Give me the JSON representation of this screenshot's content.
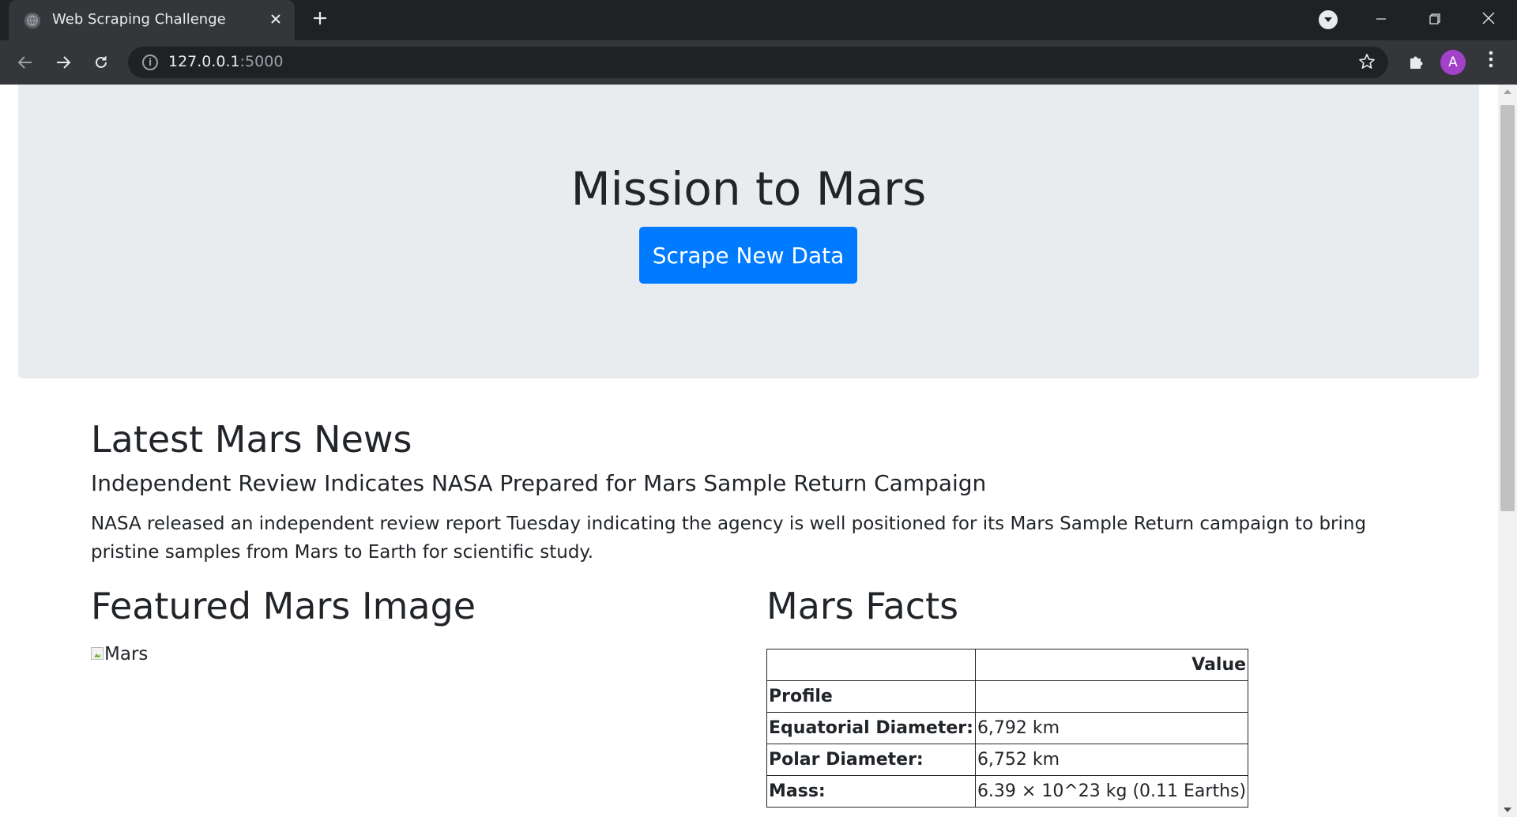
{
  "browser": {
    "tab_title": "Web Scraping Challenge",
    "url_host": "127.0.0.1",
    "url_port": ":5000",
    "avatar_letter": "A",
    "icons": {
      "favicon": "globe-icon",
      "close": "close-icon",
      "new_tab": "plus-icon",
      "back": "arrow-left-icon",
      "forward": "arrow-right-icon",
      "reload": "reload-icon",
      "info": "info-icon",
      "bookmark": "star-icon",
      "extensions": "puzzle-icon",
      "menu": "kebab-icon"
    }
  },
  "jumbotron": {
    "title": "Mission to Mars",
    "button_label": "Scrape New Data",
    "button_color": "#007bff"
  },
  "news": {
    "heading": "Latest Mars News",
    "title": "Independent Review Indicates NASA Prepared for Mars Sample Return Campaign",
    "paragraph": "NASA released an independent review report Tuesday indicating the agency is well positioned for its Mars Sample Return campaign to bring pristine samples from Mars to Earth for scientific study."
  },
  "featured": {
    "heading": "Featured Mars Image",
    "image_alt": "Mars"
  },
  "facts": {
    "heading": "Mars Facts",
    "header": [
      "",
      "Value"
    ],
    "rows": [
      {
        "label": "Profile",
        "value": ""
      },
      {
        "label": "Equatorial Diameter:",
        "value": "6,792 km"
      },
      {
        "label": "Polar Diameter:",
        "value": "6,752 km"
      },
      {
        "label": "Mass:",
        "value": "6.39 × 10^23 kg (0.11 Earths)"
      }
    ]
  }
}
